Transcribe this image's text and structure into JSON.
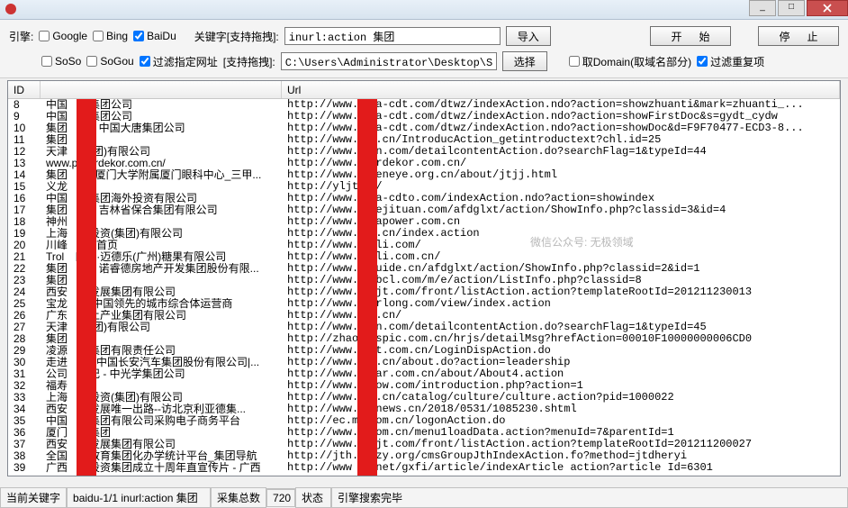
{
  "titlebar": {
    "close": "X"
  },
  "toolbar": {
    "engine_label": "引擎:",
    "engines": {
      "google": "Google",
      "bing": "Bing",
      "baidu": "BaiDu",
      "soso": "SoSo",
      "sogou": "SoGou"
    },
    "keyword_label": "关键字[支持拖拽]:",
    "keyword_value": "inurl:action 集团",
    "import": "导入",
    "start": "开  始",
    "stop": "停  止",
    "filter_url_label": "过滤指定网址",
    "support_drag_label": "[支持拖拽]:",
    "path_value": "C:\\Users\\Administrator\\Desktop\\Shell批量",
    "select": "选择",
    "take_domain": "取Domain(取域名部分)",
    "filter_dup": "过滤重复项"
  },
  "columns": {
    "id": "ID",
    "name": "",
    "url": "Url"
  },
  "watermark": "微信公众号: 无极领域",
  "rows": [
    {
      "id": "8",
      "name": "中国　唐集团公司",
      "url": "http://www.c　a-cdt.com/dtwz/indexAction.ndo?action=showzhuanti&mark=zhuanti_..."
    },
    {
      "id": "9",
      "name": "中国　唐集团公司",
      "url": "http://www.c　a-cdt.com/dtwz/indexAction.ndo?action=showFirstDoc&s=gydt_cydw"
    },
    {
      "id": "10",
      "name": "集团　闻 - 中国大唐集团公司",
      "url": "http://www.c　a-cdt.com/dtwz/indexAction.ndo?action=showDoc&d=F9F70477-ECD3-8..."
    },
    {
      "id": "11",
      "name": "集团　绍",
      "url": "http://www.l　.cn/IntroducAction_getintroductext?chl.id=25"
    },
    {
      "id": "12",
      "name": "天津　(集团)有限公司",
      "url": "http://www.p　n.com/detailcontentAction.do?searchFlag=1&typeId=44"
    },
    {
      "id": "13",
      "name": "www.p　erdekor.com.cn/",
      "url": "http://www.p　rdekor.com.cn/"
    },
    {
      "id": "14",
      "name": "集团　介_厦门大学附属厦门眼科中心_三甲...",
      "url": "http://www.x　eneye.org.cn/about/jtjj.html"
    },
    {
      "id": "15",
      "name": "义龙　团",
      "url": "http://yljt　n/"
    },
    {
      "id": "16",
      "name": "中国　唐集团海外投资有限公司",
      "url": "http://www.c　a-cdto.com/indexAction.ndo?action=showindex"
    },
    {
      "id": "17",
      "name": "集团　介 - 吉林省保合集团有限公司",
      "url": "http://www.b　ejituan.com/afdglxt/action/ShowInfo.php?classid=3&id=4"
    },
    {
      "id": "18",
      "name": "神州　业",
      "url": "http://www.u　apower.com.cn"
    },
    {
      "id": "19",
      "name": "上海　业投资(集团)有限公司",
      "url": "http://www.s　.cn/index.action"
    },
    {
      "id": "20",
      "name": "川峰　团)-首页",
      "url": "http://www.g　li.com/"
    },
    {
      "id": "21",
      "name": "Trol　口力·迈德乐(广州)糖果有限公司",
      "url": "http://www.t　li.com.cn/"
    },
    {
      "id": "22",
      "name": "集团　介 - 诺睿德房地产开发集团股份有限...",
      "url": "http://www.n　uide.cn/afdglxt/action/ShowInfo.php?classid=2&id=1"
    },
    {
      "id": "23",
      "name": "集团　介",
      "url": "http://www.s　bcl.com/m/e/action/ListInfo.php?classid=8"
    },
    {
      "id": "24",
      "name": "西安　东发展集团有限公司",
      "url": "http://www.x　jt.com/front/listAction.action?templateRootId=201211230013"
    },
    {
      "id": "25",
      "name": "宝龙　产,中国领先的城市综合体运营商",
      "url": "http://www.p　rlong.com/view/index.action"
    },
    {
      "id": "26",
      "name": "广东　稀土产业集团有限公司",
      "url": "http://www.g　.cn/"
    },
    {
      "id": "27",
      "name": "天津　(集团)有限公司",
      "url": "http://www.p　n.com/detailcontentAction.do?searchFlag=1&typeId=45"
    },
    {
      "id": "28",
      "name": "集团　介",
      "url": "http://zhaop　spic.com.cn/hrjs/detailMsg?hrefAction=00010F10000000006CD0"
    },
    {
      "id": "29",
      "name": "凌源　铁集团有限责任公司",
      "url": "http://www.l　t.com.cn/LoginDispAction.do"
    },
    {
      "id": "30",
      "name": "走进　安--中国长安汽车集团股份有限公司|...",
      "url": "http://www.c　.cn/about.do?action=leadership"
    },
    {
      "id": "31",
      "name": "公司　事记 - 中光学集团公司",
      "url": "http://www.c　ar.com.cn/about/About4.action"
    },
    {
      "id": "32",
      "name": "福寿　团",
      "url": "http://www.f　ow.com/introduction.php?action=1"
    },
    {
      "id": "33",
      "name": "上海　业投资(集团)有限公司",
      "url": "http://www.s　.cn/catalog/culture/culture.action?pid=1000022"
    },
    {
      "id": "34",
      "name": "西安　所发展唯一出路--访北京利亚德集...",
      "url": "http://www.0　news.cn/2018/0531/1085230.shtml"
    },
    {
      "id": "35",
      "name": "中国　矿集团有限公司采购电子商务平台",
      "url": "http://ec.mc　om.cn/logonAction.do"
    },
    {
      "id": "36",
      "name": "厦门　游集团",
      "url": "http://www.x　om.cn/menu1loadData.action?menuId=7&parentId=1"
    },
    {
      "id": "37",
      "name": "西安　东发展集团有限公司",
      "url": "http://www.x　jt.com/front/listAction.action?templateRootId=201211200027"
    },
    {
      "id": "38",
      "name": "全国　业教育集团化办学统计平台_集团导航",
      "url": "http://jth.c　zy.org/cmsGroupJthIndexAction.fo?method=jtdheryi"
    },
    {
      "id": "39",
      "name": "广西　融投资集团成立十周年直宣传片 - 广西",
      "url": "http://www g　net/gxfi/article/indexArticle action?article Id=6301"
    }
  ],
  "status": {
    "current_kw_label": "当前关键字",
    "current_kw": "baidu-1/1 inurl:action 集团",
    "total_label": "采集总数",
    "total": "720",
    "state_label": "状态",
    "state": "引擎搜索完毕"
  }
}
